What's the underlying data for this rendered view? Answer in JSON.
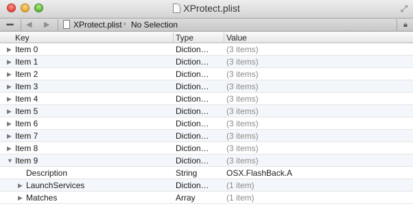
{
  "window": {
    "title": "XProtect.plist"
  },
  "jumpbar": {
    "back": "◀",
    "forward": "▶",
    "file": "XProtect.plist",
    "arrow": "›",
    "selection": "No Selection"
  },
  "columns": {
    "key": "Key",
    "type": "Type",
    "value": "Value"
  },
  "rows": [
    {
      "key": "Item 0",
      "type": "Diction…",
      "value": "(3 items)",
      "level": 0,
      "expanded": false
    },
    {
      "key": "Item 1",
      "type": "Diction…",
      "value": "(3 items)",
      "level": 0,
      "expanded": false
    },
    {
      "key": "Item 2",
      "type": "Diction…",
      "value": "(3 items)",
      "level": 0,
      "expanded": false
    },
    {
      "key": "Item 3",
      "type": "Diction…",
      "value": "(3 items)",
      "level": 0,
      "expanded": false
    },
    {
      "key": "Item 4",
      "type": "Diction…",
      "value": "(3 items)",
      "level": 0,
      "expanded": false
    },
    {
      "key": "Item 5",
      "type": "Diction…",
      "value": "(3 items)",
      "level": 0,
      "expanded": false
    },
    {
      "key": "Item 6",
      "type": "Diction…",
      "value": "(3 items)",
      "level": 0,
      "expanded": false
    },
    {
      "key": "Item 7",
      "type": "Diction…",
      "value": "(3 items)",
      "level": 0,
      "expanded": false
    },
    {
      "key": "Item 8",
      "type": "Diction…",
      "value": "(3 items)",
      "level": 0,
      "expanded": false
    },
    {
      "key": "Item 9",
      "type": "Diction…",
      "value": "(3 items)",
      "level": 0,
      "expanded": true
    },
    {
      "key": "Description",
      "type": "String",
      "value": "OSX.FlashBack.A",
      "level": 1,
      "leaf": true
    },
    {
      "key": "LaunchServices",
      "type": "Diction…",
      "value": "(1 item)",
      "level": 1,
      "expanded": false
    },
    {
      "key": "Matches",
      "type": "Array",
      "value": "(1 item)",
      "level": 1,
      "expanded": false
    }
  ],
  "icons": {
    "collapsed": "▶",
    "expanded": "▼"
  }
}
